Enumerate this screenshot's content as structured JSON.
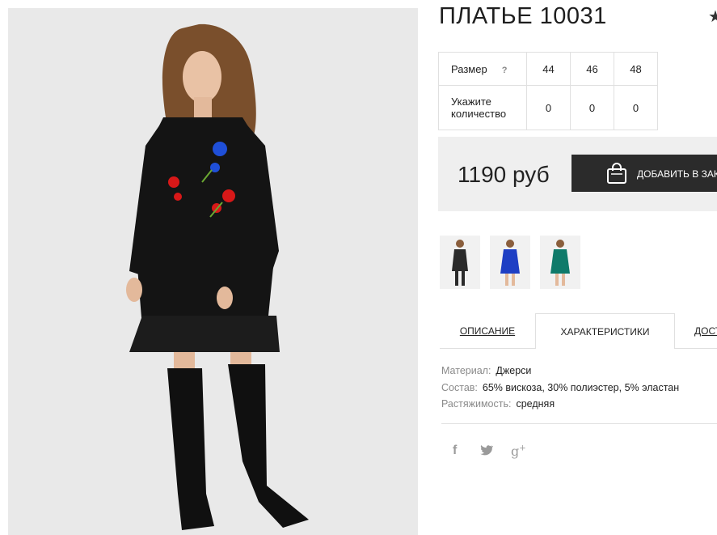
{
  "product": {
    "title": "ПЛАТЬЕ 10031",
    "price": "1190 руб",
    "add_to_cart_label": "ДОБАВИТЬ В ЗАКАЗ"
  },
  "size_table": {
    "size_label": "Размер",
    "help_symbol": "?",
    "quantity_label": "Укажите количество",
    "sizes": [
      "44",
      "46",
      "48"
    ],
    "quantities": [
      "0",
      "0",
      "0"
    ]
  },
  "color_thumbnails": [
    {
      "color": "#2a2a2a"
    },
    {
      "color": "#1e3fc4"
    },
    {
      "color": "#0f7a6a"
    }
  ],
  "tabs": [
    {
      "label": "ОПИСАНИЕ",
      "active": false
    },
    {
      "label": "ХАРАКТЕРИСТИКИ",
      "active": true
    },
    {
      "label": "ДОСТАВКА",
      "active": false
    }
  ],
  "specs": [
    {
      "label": "Материал:",
      "value": "Джерси"
    },
    {
      "label": "Состав:",
      "value": "65% вискоза, 30% полиэстер, 5% эластан"
    },
    {
      "label": "Растяжимость:",
      "value": "средняя"
    }
  ],
  "social": {
    "facebook_glyph": "f",
    "googleplus_glyph": "g",
    "googleplus_sup": "+"
  },
  "colors": {
    "dark_button": "#2b2b2b",
    "price_bg": "#efefef",
    "dress": "#141414"
  }
}
